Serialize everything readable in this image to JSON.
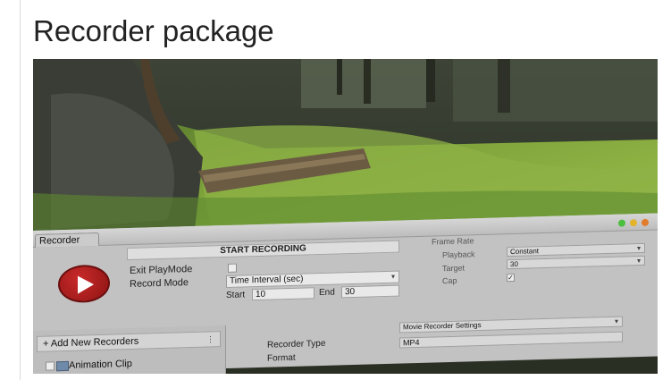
{
  "page": {
    "title": "Recorder package"
  },
  "recorder_window": {
    "tab_label": "Recorder",
    "start_recording_label": "START RECORDING",
    "exit_playmode_label": "Exit PlayMode",
    "record_mode_label": "Record Mode",
    "record_mode_value": "Time Interval (sec)",
    "start_label": "Start",
    "start_value": "10",
    "end_label": "End",
    "end_value": "30",
    "frame_rate_label": "Frame Rate",
    "playback_label": "Playback",
    "playback_value": "Constant",
    "target_label": "Target",
    "target_value": "30",
    "cap_label": "Cap",
    "cap_checked": "✓",
    "add_recorders_label": "+ Add New Recorders",
    "add_recorders_menu_glyph": "⋮",
    "animation_clip_label": "Animation Clip",
    "recorder_type_label": "Recorder Type",
    "recorder_type_value": "Movie Recorder Settings",
    "format_label": "Format",
    "format_value": "MP4",
    "dropdown_glyph": "▾"
  },
  "colors": {
    "record_button": "#b01e1e",
    "window_bg": "#c2c2c2",
    "title_text": "#222222"
  }
}
